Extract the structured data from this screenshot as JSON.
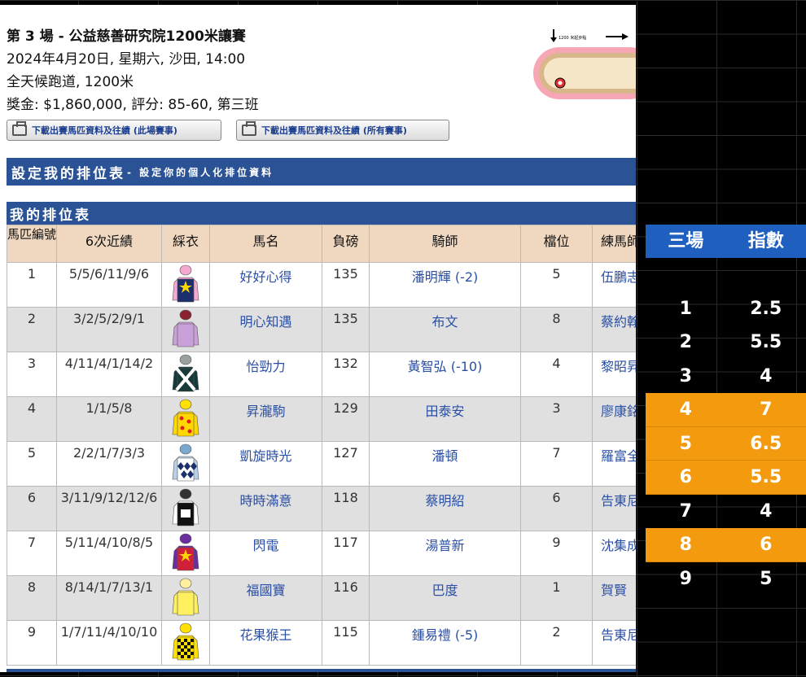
{
  "race": {
    "title": "第 3 場 - 公益慈善研究院1200米讓賽",
    "date_line": "2024年4月20日, 星期六, 沙田, 14:00",
    "track_line": "全天候跑道, 1200米",
    "prize_line": "獎金: $1,860,000, 評分: 85-60, 第三班",
    "download_this": "下載出賽馬匹資料及往績 (此場賽事)",
    "download_all": "下載出賽馬匹資料及往績 (所有賽事)",
    "track_map_label": "1200 米起步點"
  },
  "sections": {
    "setup_title": "設定我的排位表",
    "setup_sub": "- 設定你的個人化排位資料",
    "my_table_title": "我的排位表"
  },
  "table": {
    "headers": [
      "馬匹編號",
      "6次近績",
      "綵衣",
      "馬名",
      "負磅",
      "騎師",
      "檔位",
      "練馬師"
    ],
    "rows": [
      {
        "no": "1",
        "form": "5/5/6/11/9/6",
        "name": "好好心得",
        "weight": "135",
        "jockey": "潘明輝 (-2)",
        "draw": "5",
        "trainer": "伍鵬志",
        "silk": "silk-star-navy"
      },
      {
        "no": "2",
        "form": "3/2/5/2/9/1",
        "name": "明心知遇",
        "weight": "135",
        "jockey": "布文",
        "draw": "8",
        "trainer": "蔡約翰",
        "silk": "silk-lilac"
      },
      {
        "no": "3",
        "form": "4/11/4/1/14/2",
        "name": "怡勁力",
        "weight": "132",
        "jockey": "黃智弘 (-10)",
        "draw": "4",
        "trainer": "黎昭昇",
        "silk": "silk-cross-dark"
      },
      {
        "no": "4",
        "form": "1/1/5/8",
        "name": "昇瀧駒",
        "weight": "129",
        "jockey": "田泰安",
        "draw": "3",
        "trainer": "廖康銘",
        "silk": "silk-yellow-spots"
      },
      {
        "no": "5",
        "form": "2/2/1/7/3/3",
        "name": "凱旋時光",
        "weight": "127",
        "jockey": "潘頓",
        "draw": "7",
        "trainer": "羅富全",
        "silk": "silk-diamonds"
      },
      {
        "no": "6",
        "form": "3/11/9/12/12/6",
        "name": "時時滿意",
        "weight": "118",
        "jockey": "蔡明紹",
        "draw": "6",
        "trainer": "告東尼",
        "silk": "silk-black-white"
      },
      {
        "no": "7",
        "form": "5/11/4/10/8/5",
        "name": "閃電",
        "weight": "117",
        "jockey": "湯普新",
        "draw": "9",
        "trainer": "沈集成",
        "silk": "silk-purple-red"
      },
      {
        "no": "8",
        "form": "8/14/1/7/13/1",
        "name": "福國寶",
        "weight": "116",
        "jockey": "巴度",
        "draw": "1",
        "trainer": "賀賢",
        "silk": "silk-yellow"
      },
      {
        "no": "9",
        "form": "1/7/11/4/10/10",
        "name": "花果猴王",
        "weight": "115",
        "jockey": "鍾易禮 (-5)",
        "draw": "2",
        "trainer": "告東尼",
        "silk": "silk-check"
      }
    ]
  },
  "index_table": {
    "header_race": "三場",
    "header_index": "指數",
    "rows": [
      {
        "no": "1",
        "value": "2.5",
        "highlight": false
      },
      {
        "no": "2",
        "value": "5.5",
        "highlight": false
      },
      {
        "no": "3",
        "value": "4",
        "highlight": false
      },
      {
        "no": "4",
        "value": "7",
        "highlight": true
      },
      {
        "no": "5",
        "value": "6.5",
        "highlight": true
      },
      {
        "no": "6",
        "value": "5.5",
        "highlight": true
      },
      {
        "no": "7",
        "value": "4",
        "highlight": false
      },
      {
        "no": "8",
        "value": "6",
        "highlight": true
      },
      {
        "no": "9",
        "value": "5",
        "highlight": false
      }
    ],
    "highlight_color": "#f39a0e",
    "header_color": "#1f5fc0"
  },
  "colors": {
    "section_bar": "#2a5295",
    "header_bg": "#f0d8c0",
    "link_blue": "#2a4fa5"
  }
}
